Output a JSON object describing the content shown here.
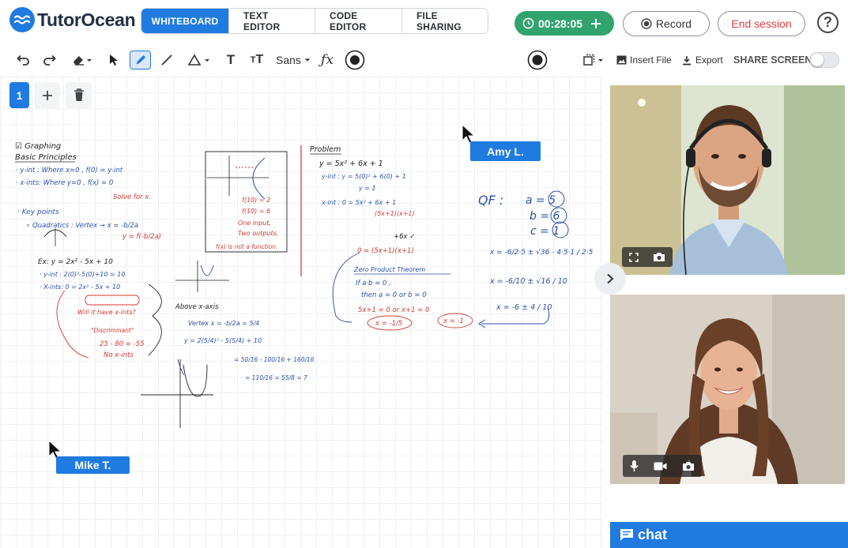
{
  "app": {
    "name": "TutorOcean"
  },
  "tabs": [
    {
      "label": "WHITEBOARD",
      "active": true
    },
    {
      "label": "TEXT EDITOR",
      "active": false
    },
    {
      "label": "CODE EDITOR",
      "active": false
    },
    {
      "label": "FILE SHARING",
      "active": false
    }
  ],
  "session": {
    "timer": "00:28:05",
    "record_label": "Record",
    "end_label": "End session",
    "help_label": "?"
  },
  "toolbar": {
    "font_label": "Sans",
    "insert_file_label": "Insert File",
    "export_label": "Export",
    "share_screen_label": "SHARE SCREEN",
    "share_screen_on": false,
    "colors": [
      "#1f1f1f",
      "#2299dd",
      "#e8403a",
      "#5cc04a",
      "#f07c34",
      "#9a35c9"
    ]
  },
  "pages": {
    "current": "1"
  },
  "collaborators": [
    {
      "name": "Amy L."
    },
    {
      "name": "Mike T."
    }
  ],
  "whiteboard": {
    "left": {
      "h1": "☑ Graphing",
      "h2": "Basic Principles",
      "l1": "· y-int : Where x=0 , f(0) = y-int",
      "l2": "· x-ints: Where y=0 , f(x) = 0",
      "l3": "Solve for x.",
      "l4": "· Key points",
      "l5": "∘ Quadratics : Vertex → x = -b/2a",
      "l6": "y = f(-b/2a)",
      "l7": "Ex:  y = 2x² - 5x + 10",
      "l8": "· y-int : 2(0)²-5(0)+10 = 10",
      "l9": "· X-ints: 0 = 2x² - 5x + 10",
      "l10": "Will it have x-ints?",
      "l11": "\"Discriminant\"",
      "l12": "25 - 80 = -55",
      "l13": "No x-ints",
      "l14": "Above x-axis",
      "l15": "Vertex  x = -b/2a = 5/4",
      "l16": "y = 2(5/4)² - 5(5/4) + 10",
      "l17": "= 50/16 - 100/16 + 160/16",
      "l18": "= 110/16 = 55/8 = 7"
    },
    "mid": {
      "f1": "f(10) = 2",
      "f2": "f(10) = 6",
      "f3": "One input,",
      "f4": "Two outputs.",
      "f5": "f(x) is not a function."
    },
    "problem": {
      "title": "Problem",
      "p1": "y = 5x² + 6x + 1",
      "p2": "y-int : y = 5(0)² + 6(0) + 1",
      "p3": "y = 1",
      "p4": "x-int : 0 = 5x² + 6x + 1",
      "p5": "(5x+1)(x+1)",
      "p6": "+6x ✓",
      "p7": "0 = (5x+1)(x+1)",
      "p8": "Zero Product Theorem",
      "p9": "If  a·b = 0 ,",
      "p10": "then  a = 0  or  b = 0",
      "p11": "5x+1 = 0   or   x+1 = 0",
      "p12": "x = -1/5",
      "p13": "x = -1"
    },
    "qf": {
      "q1": "QF :",
      "q2": "a = 5",
      "q3": "b = 6",
      "q4": "c = 1",
      "q5": "x = -6/2·5 ± √36 - 4·5·1 / 2·5",
      "q6": "x = -6/10 ± √16 / 10",
      "q7": "x = -6 ± 4 / 10"
    }
  },
  "chat": {
    "label": "chat"
  }
}
